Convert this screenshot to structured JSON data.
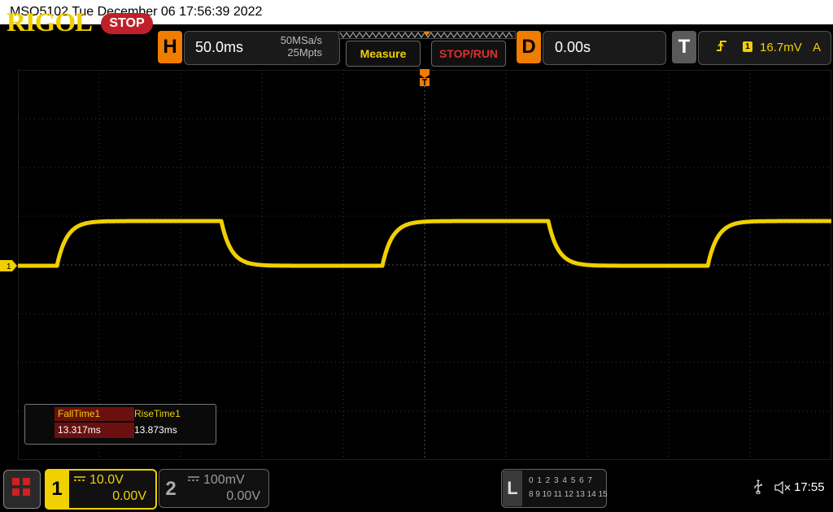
{
  "title_bar": {
    "text": "MSO5102  Tue December 06 17:56:39 2022"
  },
  "brand": {
    "logo": "RIGOL",
    "run_state": "STOP"
  },
  "horizontal": {
    "letter": "H",
    "timebase": "50.0ms",
    "sample_rate": "50MSa/s",
    "memory_depth": "25Mpts"
  },
  "buttons": {
    "measure": "Measure",
    "stop_run": "STOP/RUN"
  },
  "delay": {
    "letter": "D",
    "value": "0.00s"
  },
  "trigger": {
    "letter": "T",
    "slope_icon": "rising-edge-icon",
    "source": "1",
    "level": "16.7mV",
    "mode": "A"
  },
  "ch1_marker": "1",
  "measurements": {
    "fall": {
      "name": "FallTime1",
      "value": "13.317ms"
    },
    "rise": {
      "name": "RiseTime1",
      "value": "13.873ms"
    }
  },
  "channels": {
    "ch1": {
      "number": "1",
      "scale": "10.0V",
      "offset": "0.00V",
      "color": "#f0d000"
    },
    "ch2": {
      "number": "2",
      "scale": "100mV",
      "offset": "0.00V",
      "color": "#999999"
    }
  },
  "logic": {
    "letter": "L",
    "row1": "0 1 2 3  4 5 6 7",
    "row2": "8 9 10 11 12 13 14 15"
  },
  "status": {
    "time": "17:55"
  },
  "colors": {
    "trace": "#f0d000",
    "accent": "#f07d00",
    "stop_red": "#c0202a",
    "grid": "#3a3a3a"
  }
}
